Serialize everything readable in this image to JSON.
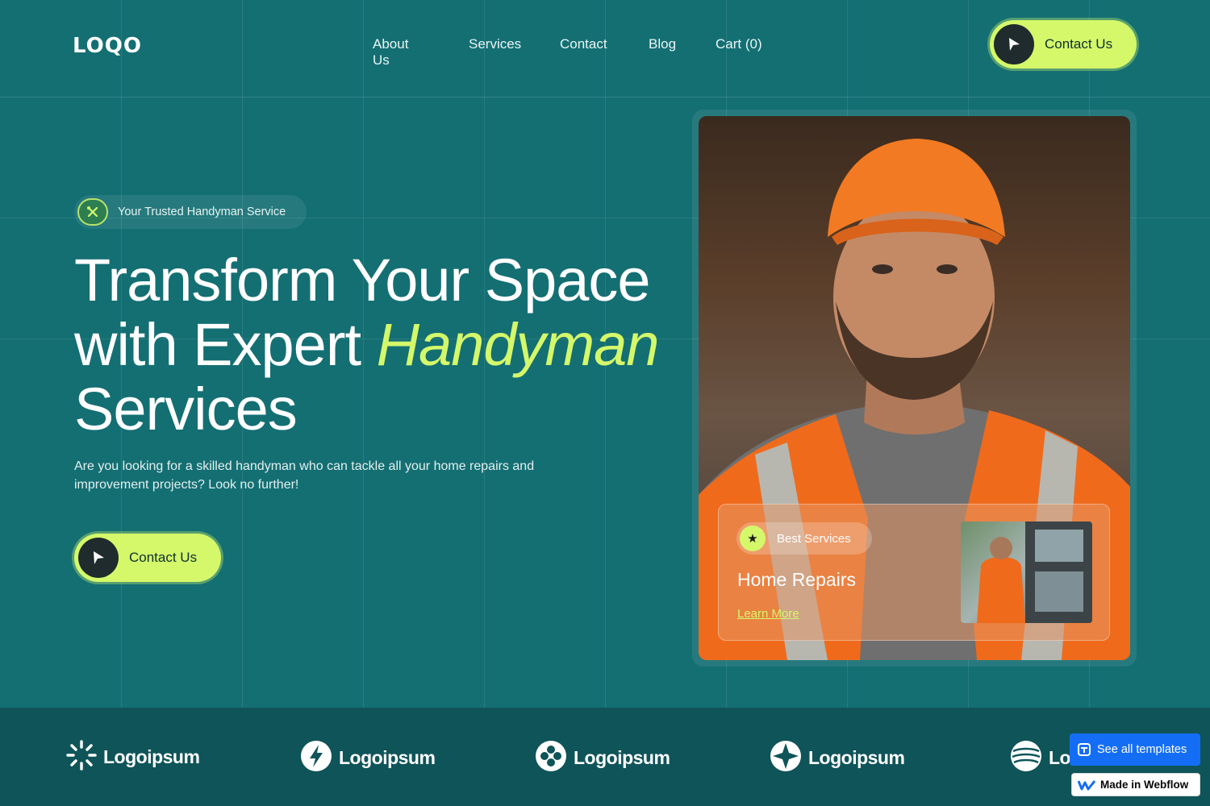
{
  "header": {
    "logo_text": "LOQO",
    "nav": [
      "About Us",
      "Services",
      "Contact",
      "Blog",
      "Cart (0)"
    ],
    "cta_label": "Contact Us"
  },
  "hero": {
    "badge_text": "Your Trusted Handyman Service",
    "title_line1": "Transform Your Space",
    "title_line2_prefix": "with Expert ",
    "title_accent": "Handyman",
    "title_line3": "Services",
    "description": "Are you looking for a skilled handyman who can tackle all your home repairs and improvement projects? Look no further!",
    "cta_label": "Contact Us"
  },
  "service_card": {
    "badge": "Best Services",
    "title": "Home Repairs",
    "link": "Learn More"
  },
  "partners": [
    "Logoipsum",
    "Logoipsum",
    "Logoipsum",
    "Logoipsum",
    "Lo"
  ],
  "webflow": {
    "templates_label": "See all templates",
    "made_label": "Made in Webflow"
  },
  "colors": {
    "background": "#146f73",
    "accent": "#d4f86a",
    "band": "#0f5459",
    "webflow_blue": "#146ef5"
  }
}
